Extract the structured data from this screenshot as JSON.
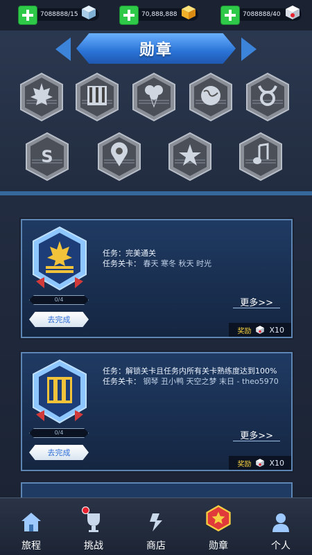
{
  "resources": [
    {
      "value": "7088888/15",
      "icon": "ice-cube-icon"
    },
    {
      "value": "70,888,888",
      "icon": "gold-cube-icon"
    },
    {
      "value": "7088888/40",
      "icon": "red-cube-icon"
    }
  ],
  "header": {
    "title": "勋章"
  },
  "badges": [
    {
      "icon": "maple-leaf-icon"
    },
    {
      "icon": "piano-icon"
    },
    {
      "icon": "balloons-icon"
    },
    {
      "icon": "globe-icon"
    },
    {
      "icon": "taurus-icon"
    },
    {
      "icon": "s-letter-icon"
    },
    {
      "icon": "location-pin-icon"
    },
    {
      "icon": "star-icon"
    },
    {
      "icon": "music-note-icon"
    }
  ],
  "cards": [
    {
      "task_label": "任务：完美通关",
      "levels_label": "任务关卡：",
      "levels": "春天 寒冬 秋天 时光",
      "progress": "0/4",
      "go_label": "去完成",
      "more_label": "更多>>",
      "reward_label": "奖励",
      "reward_count": "X10",
      "icon": "maple-leaf-icon"
    },
    {
      "task_label": "任务：解锁关卡且任务内所有关卡熟练度达到100%",
      "levels_label": "任务关卡：",
      "levels": "钢琴 丑小鸭 天空之梦 末日 - theo5970",
      "progress": "0/4",
      "go_label": "去完成",
      "more_label": "更多>>",
      "reward_label": "奖励",
      "reward_count": "X10",
      "icon": "piano-icon"
    }
  ],
  "nav": [
    {
      "label": "旅程",
      "icon": "house-icon"
    },
    {
      "label": "挑战",
      "icon": "trophy-icon"
    },
    {
      "label": "商店",
      "icon": "store-icon"
    },
    {
      "label": "勋章",
      "icon": "medal-icon"
    },
    {
      "label": "个人",
      "icon": "person-icon"
    }
  ],
  "colors": {
    "accent": "#3c84d9",
    "green": "#2fc94a",
    "gold": "#f6d040",
    "background": "#222c40"
  }
}
